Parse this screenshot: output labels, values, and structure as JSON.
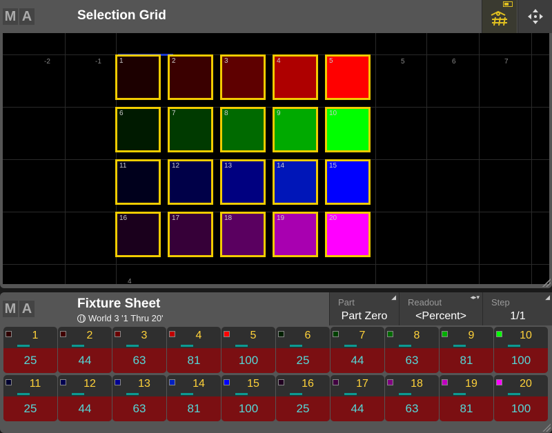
{
  "selection_grid": {
    "title": "Selection Grid",
    "axis_labels": [
      "-2",
      "-1",
      "5",
      "6",
      "7"
    ],
    "bottom_axis_label": "4",
    "cells": [
      {
        "n": "1",
        "color": "#1c0000"
      },
      {
        "n": "2",
        "color": "#3a0000"
      },
      {
        "n": "3",
        "color": "#5e0000"
      },
      {
        "n": "4",
        "color": "#ae0000"
      },
      {
        "n": "5",
        "color": "#ff0000"
      },
      {
        "n": "6",
        "color": "#001a00"
      },
      {
        "n": "7",
        "color": "#003a00"
      },
      {
        "n": "8",
        "color": "#006a00"
      },
      {
        "n": "9",
        "color": "#00aa00"
      },
      {
        "n": "10",
        "color": "#00ff00"
      },
      {
        "n": "11",
        "color": "#00001c"
      },
      {
        "n": "12",
        "color": "#000048"
      },
      {
        "n": "13",
        "color": "#000080"
      },
      {
        "n": "14",
        "color": "#0016b8"
      },
      {
        "n": "15",
        "color": "#0000ff"
      },
      {
        "n": "16",
        "color": "#1a001c"
      },
      {
        "n": "17",
        "color": "#360038"
      },
      {
        "n": "18",
        "color": "#5a0060"
      },
      {
        "n": "19",
        "color": "#a800b0"
      },
      {
        "n": "20",
        "color": "#ff00ff"
      }
    ]
  },
  "fixture_sheet": {
    "title": "Fixture Sheet",
    "subtitle": "World 3 '1 Thru 20'",
    "part": {
      "caption": "Part",
      "value": "Part Zero"
    },
    "readout": {
      "caption": "Readout",
      "value": "<Percent>"
    },
    "step": {
      "caption": "Step",
      "value": "1/1"
    },
    "channels": [
      {
        "id": "1",
        "dim": "25",
        "color": "#300000"
      },
      {
        "id": "2",
        "dim": "44",
        "color": "#400000"
      },
      {
        "id": "3",
        "dim": "63",
        "color": "#6a0000"
      },
      {
        "id": "4",
        "dim": "81",
        "color": "#c00000"
      },
      {
        "id": "5",
        "dim": "100",
        "color": "#ff0000"
      },
      {
        "id": "6",
        "dim": "25",
        "color": "#002000"
      },
      {
        "id": "7",
        "dim": "44",
        "color": "#004000"
      },
      {
        "id": "8",
        "dim": "63",
        "color": "#006a00"
      },
      {
        "id": "9",
        "dim": "81",
        "color": "#00b000"
      },
      {
        "id": "10",
        "dim": "100",
        "color": "#00ff00"
      },
      {
        "id": "11",
        "dim": "25",
        "color": "#000030"
      },
      {
        "id": "12",
        "dim": "44",
        "color": "#000050"
      },
      {
        "id": "13",
        "dim": "63",
        "color": "#000090"
      },
      {
        "id": "14",
        "dim": "81",
        "color": "#0020c0"
      },
      {
        "id": "15",
        "dim": "100",
        "color": "#0000ff"
      },
      {
        "id": "16",
        "dim": "25",
        "color": "#200020"
      },
      {
        "id": "17",
        "dim": "44",
        "color": "#400040"
      },
      {
        "id": "18",
        "dim": "63",
        "color": "#800080"
      },
      {
        "id": "19",
        "dim": "81",
        "color": "#c000c0"
      },
      {
        "id": "20",
        "dim": "100",
        "color": "#ff00ff"
      }
    ]
  },
  "brand": {
    "m": "M",
    "a": "A"
  },
  "icons": {
    "selection_tool": "selection-grid-tool-icon",
    "move_tool": "move-arrows-icon",
    "world": "globe-icon"
  },
  "accent_color": "#f2cc00"
}
